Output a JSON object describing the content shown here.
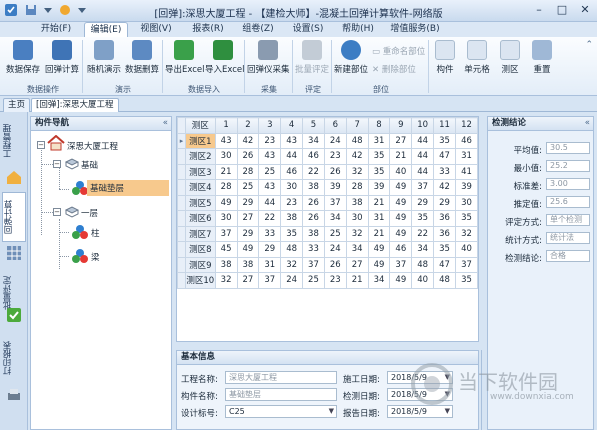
{
  "window": {
    "title": "[回弹]:深思大厦工程 - 【建检大师】-混凝土回弹计算软件-网络版"
  },
  "menu": {
    "tabs": [
      "开始(F)",
      "编辑(E)",
      "视图(V)",
      "报表(R)",
      "组卷(Z)",
      "设置(S)",
      "帮助(H)",
      "增值服务(B)"
    ],
    "active": "编辑(E)"
  },
  "ribbon": {
    "buttons": [
      "数据保存",
      "回弹计算",
      "随机演示",
      "数据删算",
      "导出Excel",
      "导入Excel",
      "回弹仪采集",
      "批量评定",
      "新建部位",
      "构件",
      "单元格",
      "测区",
      "重置"
    ],
    "small_buttons": [
      "重命名部位",
      "删除部位"
    ],
    "groups": [
      "数据操作",
      "演示",
      "数据导入",
      "采集",
      "评定",
      "部位"
    ]
  },
  "doc_tabs": {
    "home": "主页",
    "active": "[回弹]:深思大厦工程"
  },
  "left_strip": {
    "tabs": [
      "工程管理",
      "回弹计算",
      "批量评定",
      "打印报表"
    ]
  },
  "nav": {
    "title": "构件导航",
    "collapse": "«",
    "tree": {
      "root": "深思大厦工程",
      "floor1": "基础",
      "item1": "基础垫层",
      "floor2": "一层",
      "item2": "柱",
      "item3": "梁"
    }
  },
  "grid": {
    "corner": "测区",
    "columns": [
      "1",
      "2",
      "3",
      "4",
      "5",
      "6",
      "7",
      "8",
      "9",
      "10",
      "11",
      "12"
    ],
    "rows": [
      {
        "label": "测区1",
        "values": [
          43,
          42,
          23,
          43,
          34,
          24,
          48,
          31,
          27,
          44,
          35,
          46
        ]
      },
      {
        "label": "测区2",
        "values": [
          30,
          26,
          43,
          44,
          46,
          23,
          42,
          35,
          21,
          44,
          47,
          31
        ]
      },
      {
        "label": "测区3",
        "values": [
          21,
          28,
          25,
          46,
          22,
          26,
          32,
          35,
          40,
          44,
          33,
          41
        ]
      },
      {
        "label": "测区4",
        "values": [
          28,
          25,
          43,
          30,
          38,
          39,
          28,
          39,
          49,
          37,
          42,
          39
        ]
      },
      {
        "label": "测区5",
        "values": [
          49,
          29,
          44,
          23,
          26,
          37,
          38,
          21,
          49,
          29,
          29,
          30
        ]
      },
      {
        "label": "测区6",
        "values": [
          30,
          27,
          22,
          38,
          26,
          34,
          30,
          31,
          49,
          35,
          36,
          35
        ]
      },
      {
        "label": "测区7",
        "values": [
          37,
          29,
          33,
          35,
          38,
          25,
          32,
          21,
          49,
          22,
          36,
          32
        ]
      },
      {
        "label": "测区8",
        "values": [
          45,
          49,
          29,
          48,
          33,
          24,
          34,
          49,
          46,
          34,
          35,
          40
        ]
      },
      {
        "label": "测区9",
        "values": [
          38,
          38,
          31,
          32,
          37,
          26,
          27,
          49,
          37,
          48,
          47,
          37
        ]
      },
      {
        "label": "测区10",
        "values": [
          32,
          27,
          37,
          24,
          25,
          23,
          21,
          34,
          49,
          40,
          48,
          35
        ]
      }
    ]
  },
  "result": {
    "title": "检测结论",
    "collapse": "«",
    "fields": [
      {
        "label": "平均值:",
        "value": "30.5"
      },
      {
        "label": "最小值:",
        "value": "25.2"
      },
      {
        "label": "标准差:",
        "value": "3.00"
      },
      {
        "label": "推定值:",
        "value": "25.6"
      },
      {
        "label": "评定方式:",
        "value": "单个检测"
      },
      {
        "label": "统计方式:",
        "value": "统计法"
      },
      {
        "label": "检测结论:",
        "value": "合格"
      }
    ]
  },
  "basic": {
    "title": "基本信息",
    "project_label": "工程名称:",
    "project_value": "深思大厦工程",
    "member_label": "构件名称:",
    "member_value": "基础垫层",
    "grade_label": "设计标号:",
    "grade_value": "C25",
    "build_label": "施工日期:",
    "build_value": "2018/5/9",
    "test_label": "检测日期:",
    "test_value": "2018/5/9",
    "report_label": "报告日期:",
    "report_value": "2018/5/9"
  },
  "watermark": {
    "text": "当下软件园",
    "url": "www.downxia.com"
  }
}
